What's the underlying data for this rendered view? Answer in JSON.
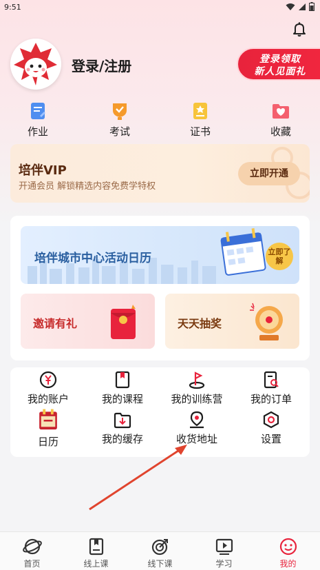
{
  "status_bar": {
    "time": "9:51"
  },
  "profile": {
    "login_label": "登录/注册",
    "promo_line1": "登录领取",
    "promo_line2": "新人见面礼"
  },
  "quick_actions": [
    {
      "label": "作业",
      "icon": "homework-icon"
    },
    {
      "label": "考试",
      "icon": "exam-icon"
    },
    {
      "label": "证书",
      "icon": "certificate-icon"
    },
    {
      "label": "收藏",
      "icon": "favorites-icon"
    }
  ],
  "vip": {
    "title": "培伴VIP",
    "subtitle": "开通会员 解锁精选内容免费学特权",
    "button": "立即开通"
  },
  "events": {
    "calendar_banner": "培伴城市中心活动日历",
    "learn_more": "立即了解",
    "invite": "邀请有礼",
    "lottery": "天天抽奖"
  },
  "services": [
    {
      "label": "我的账户",
      "icon": "yen-account-icon"
    },
    {
      "label": "我的课程",
      "icon": "course-bookmark-icon"
    },
    {
      "label": "我的训练营",
      "icon": "training-camp-flag-icon"
    },
    {
      "label": "我的订单",
      "icon": "order-search-icon"
    },
    {
      "label": "日历",
      "icon": "calendar-icon"
    },
    {
      "label": "我的缓存",
      "icon": "download-cache-icon"
    },
    {
      "label": "收货地址",
      "icon": "location-pin-icon"
    },
    {
      "label": "设置",
      "icon": "settings-hexagon-icon"
    }
  ],
  "bottom_nav": [
    {
      "label": "首页",
      "icon": "planet-home-icon",
      "active": false
    },
    {
      "label": "线上课",
      "icon": "online-course-icon",
      "active": false
    },
    {
      "label": "线下课",
      "icon": "target-offline-icon",
      "active": false
    },
    {
      "label": "学习",
      "icon": "play-study-icon",
      "active": false
    },
    {
      "label": "我的",
      "icon": "smiley-mine-icon",
      "active": true
    }
  ],
  "colors": {
    "brand_red": "#e8233c",
    "vip_brown": "#5a2a10",
    "banner_blue": "#2a5fa0"
  }
}
